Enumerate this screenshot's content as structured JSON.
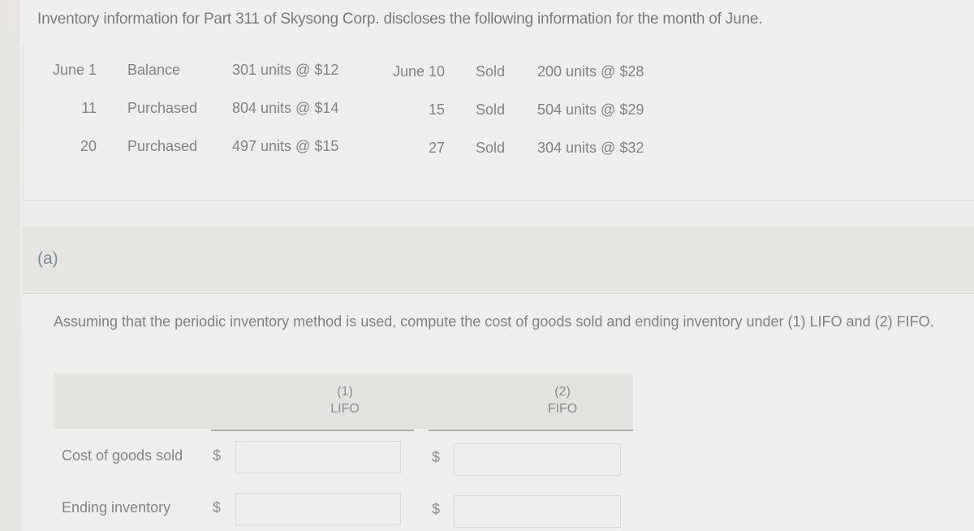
{
  "intro_text": "Inventory information for Part 311 of Skysong Corp. discloses the following information for the month of June.",
  "inventory_left": [
    {
      "date": "June 1",
      "type": "Balance",
      "detail": "301 units @ $12"
    },
    {
      "date": "11",
      "type": "Purchased",
      "detail": "804 units @ $14"
    },
    {
      "date": "20",
      "type": "Purchased",
      "detail": "497 units @ $15"
    }
  ],
  "inventory_right": [
    {
      "date": "June 10",
      "type": "Sold",
      "detail": "200 units @ $28"
    },
    {
      "date": "15",
      "type": "Sold",
      "detail": "504 units @ $29"
    },
    {
      "date": "27",
      "type": "Sold",
      "detail": "304 units @ $32"
    }
  ],
  "part": {
    "label": "(a)",
    "question": "Assuming that the periodic inventory method is used, compute the cost of goods sold and ending inventory under (1) LIFO and (2) FIFO."
  },
  "table": {
    "columns": [
      {
        "number": "(1)",
        "name": "LIFO"
      },
      {
        "number": "(2)",
        "name": "FIFO"
      }
    ],
    "currency_symbol": "$",
    "rows": [
      {
        "label": "Cost of goods sold",
        "lifo_value": "",
        "fifo_value": ""
      },
      {
        "label": "Ending inventory",
        "lifo_value": "",
        "fifo_value": ""
      }
    ]
  }
}
